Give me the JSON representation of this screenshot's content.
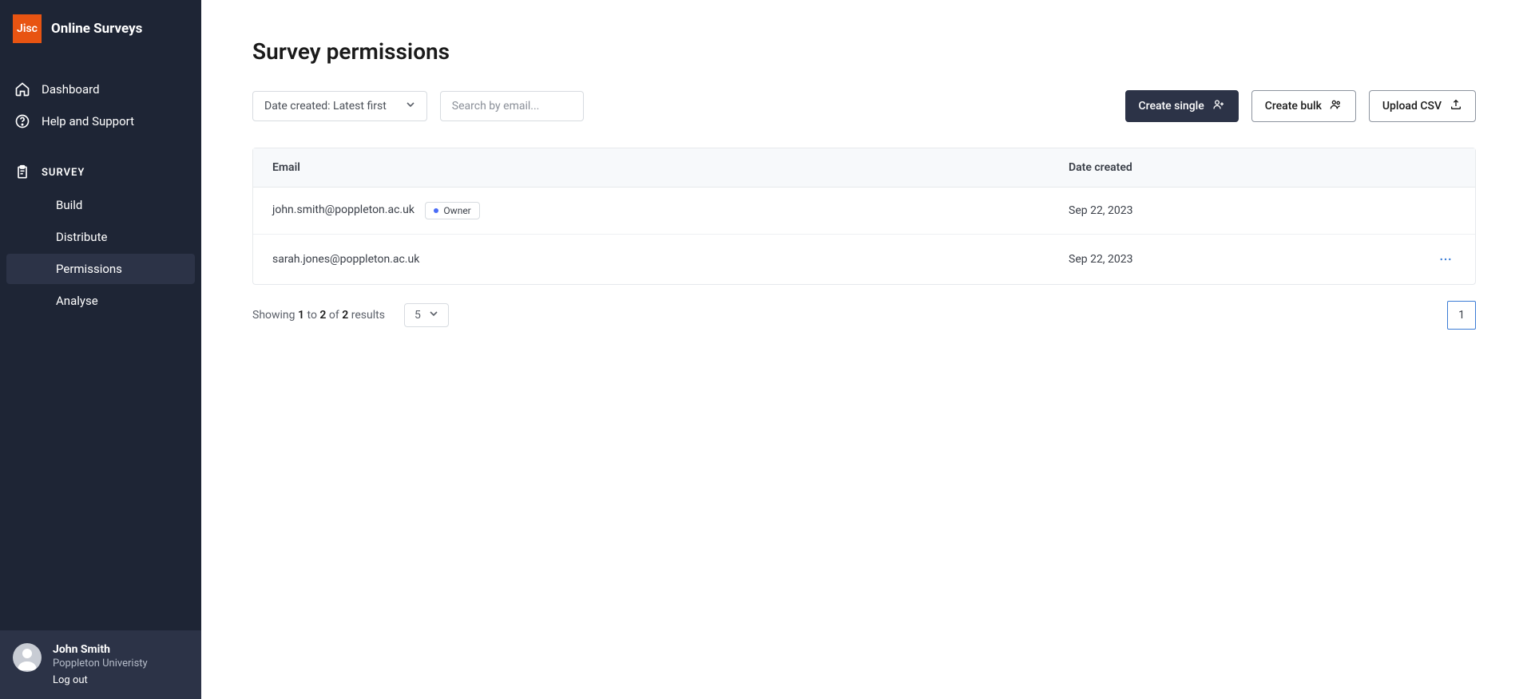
{
  "brand": {
    "logo": "Jisc",
    "name": "Online Surveys"
  },
  "nav": {
    "dashboard": "Dashboard",
    "help": "Help and Support",
    "section": "SURVEY",
    "build": "Build",
    "distribute": "Distribute",
    "permissions": "Permissions",
    "analyse": "Analyse"
  },
  "user": {
    "name": "John Smith",
    "org": "Poppleton Univeristy",
    "logout": "Log out"
  },
  "page": {
    "title": "Survey permissions"
  },
  "toolbar": {
    "sort_label": "Date created: Latest first",
    "search_placeholder": "Search by email...",
    "create_single": "Create single",
    "create_bulk": "Create bulk",
    "upload_csv": "Upload CSV"
  },
  "table": {
    "headers": {
      "email": "Email",
      "date": "Date created"
    },
    "rows": [
      {
        "email": "john.smith@poppleton.ac.uk",
        "badge": "Owner",
        "date": "Sep 22, 2023",
        "menu": false
      },
      {
        "email": "sarah.jones@poppleton.ac.uk",
        "badge": "",
        "date": "Sep 22, 2023",
        "menu": true
      }
    ]
  },
  "results": {
    "showing": "Showing",
    "from": "1",
    "to_word": "to",
    "to": "2",
    "of_word": "of",
    "total": "2",
    "results_word": "results",
    "page_size": "5",
    "current_page": "1"
  }
}
